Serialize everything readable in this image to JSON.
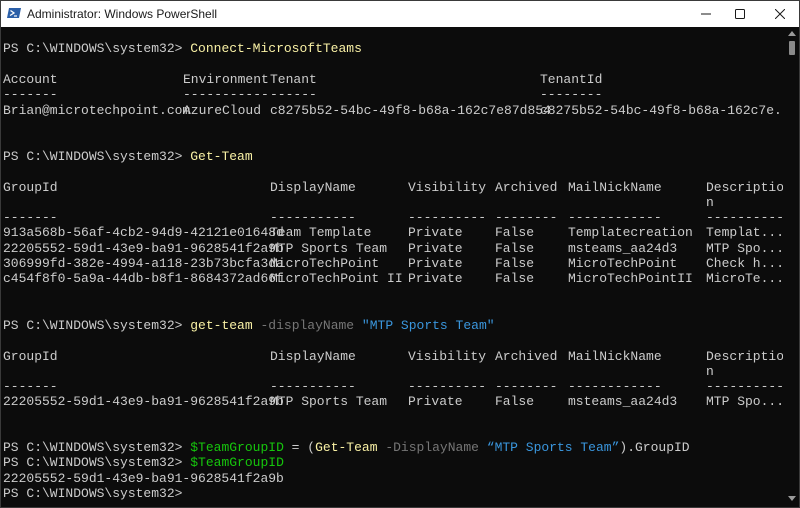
{
  "window": {
    "title": "Administrator: Windows PowerShell",
    "icon": "powershell-icon",
    "controls": [
      "minimize-icon",
      "maximize-icon",
      "close-icon"
    ]
  },
  "session": {
    "prompt": "PS C:\\WINDOWS\\system32>",
    "commands": {
      "connect": "Connect-MicrosoftTeams",
      "get_team": "Get-Team",
      "get_team_lower": "get-team",
      "display_name_param": "-displayName",
      "display_name_param_cap": "-DisplayName",
      "team_name_quoted": "\"MTP Sports Team\"",
      "team_name_smart_quoted": "“MTP Sports Team”",
      "team_group_id_var": "$TeamGroupID",
      "assign_eq": " = ",
      "open_paren": "(",
      "close_paren_prop": ").GroupID"
    },
    "connect_output": {
      "headers": [
        "Account",
        "Environment",
        "Tenant",
        "TenantId"
      ],
      "dashes": [
        "-------",
        "-----------",
        "------",
        "--------"
      ],
      "row": [
        "Brian@microtechpoint.com",
        "AzureCloud",
        "c8275b52-54bc-49f8-b68a-162c7e87d854",
        "c8275b52-54bc-49f8-b68a-162c7e..."
      ]
    },
    "team_table": {
      "headers": [
        "GroupId",
        "DisplayName",
        "Visibility",
        "Archived",
        "MailNickName",
        "Descriptio"
      ],
      "header_wrap": "n",
      "dashes": [
        "-------",
        "-----------",
        "----------",
        "--------",
        "------------",
        "----------"
      ],
      "rows": [
        [
          "913a568b-56af-4cb2-94d9-42121e01648d",
          "Team Template",
          "Private",
          "False",
          "Templatecreation",
          "Templat..."
        ],
        [
          "22205552-59d1-43e9-ba91-9628541f2a9b",
          "MTP Sports Team",
          "Private",
          "False",
          "msteams_aa24d3",
          "MTP Spo..."
        ],
        [
          "306999fd-382e-4994-a118-23b73bcfa3da",
          "MicroTechPoint",
          "Private",
          "False",
          "MicroTechPoint",
          "Check h..."
        ],
        [
          "c454f8f0-5a9a-44db-b8f1-8684372ad66f",
          "MicroTechPoint II",
          "Private",
          "False",
          "MicroTechPointII",
          "MicroTe..."
        ]
      ]
    },
    "filtered_table": {
      "row": [
        "22205552-59d1-43e9-ba91-9628541f2a9b",
        "MTP Sports Team",
        "Private",
        "False",
        "msteams_aa24d3",
        "MTP Spo..."
      ]
    },
    "group_id_output": "22205552-59d1-43e9-ba91-9628541f2a9b"
  },
  "colors": {
    "background": "#0c0c0c",
    "text": "#cccccc",
    "command": "#f9f1a5",
    "parameter": "#767676",
    "string": "#3a96dd",
    "variable": "#16c60c"
  }
}
